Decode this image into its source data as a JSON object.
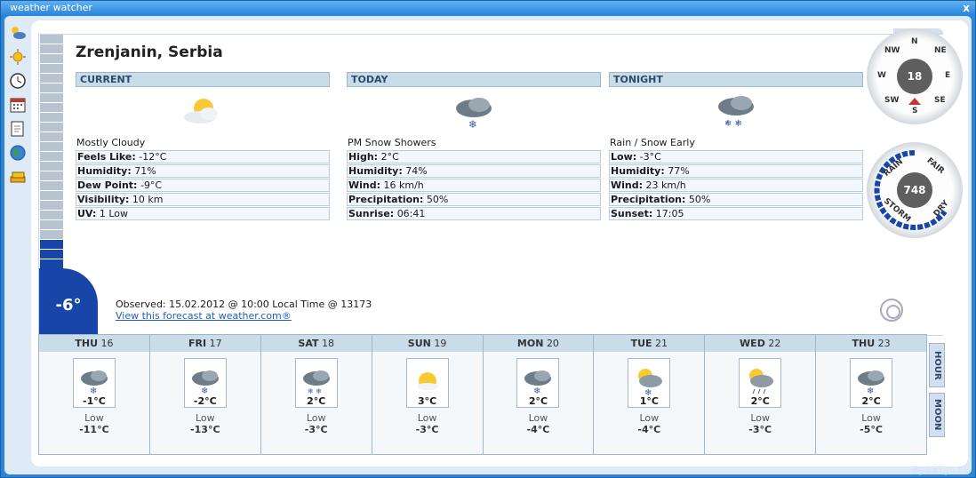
{
  "window": {
    "title": "weather watcher",
    "close": "x",
    "brand": "mycity.rs"
  },
  "toolbar": [
    "weather-icon",
    "sun-icon",
    "clock-icon",
    "calendar-icon",
    "notes-icon",
    "globe-icon",
    "stack-icon"
  ],
  "location": "Zrenjanin, Serbia",
  "temperature": "-6°",
  "current": {
    "header": "CURRENT",
    "icon": "partly-cloudy-icon",
    "condition": "Mostly Cloudy",
    "rows": [
      {
        "label": "Feels Like:",
        "value": "-12°C"
      },
      {
        "label": "Humidity:",
        "value": "71%"
      },
      {
        "label": "Dew Point:",
        "value": "-9°C"
      },
      {
        "label": "Visibility:",
        "value": "10 km"
      },
      {
        "label": "UV:",
        "value": "1 Low"
      }
    ]
  },
  "today": {
    "header": "TODAY",
    "icon": "snow-cloud-icon",
    "condition": "PM Snow Showers",
    "rows": [
      {
        "label": "High:",
        "value": "2°C"
      },
      {
        "label": "Humidity:",
        "value": " 74%"
      },
      {
        "label": "Wind:",
        "value": " 16 km/h"
      },
      {
        "label": "Precipitation:",
        "value": " 50%"
      },
      {
        "label": "Sunrise:",
        "value": "06:41"
      }
    ]
  },
  "tonight": {
    "header": "TONIGHT",
    "icon": "rain-snow-icon",
    "condition": "Rain / Snow Early",
    "rows": [
      {
        "label": "Low:",
        "value": "-3°C"
      },
      {
        "label": "Humidity:",
        "value": " 77%"
      },
      {
        "label": "Wind:",
        "value": " 23 km/h"
      },
      {
        "label": "Precipitation:",
        "value": " 50%"
      },
      {
        "label": "Sunset:",
        "value": "17:05"
      }
    ]
  },
  "observed": "Observed: 15.02.2012 @ 10:00 Local Time @ 13173",
  "link": "View this forecast at weather.com®",
  "compass": {
    "value": "18",
    "labels": [
      "N",
      "NE",
      "E",
      "SE",
      "S",
      "SW",
      "W",
      "NW"
    ]
  },
  "barometer": {
    "value": "748",
    "labels": [
      "RAIN",
      "FAIR",
      "STORM",
      "DRY"
    ]
  },
  "forecast": [
    {
      "day": "THU",
      "date": "16",
      "hi": "-1°C",
      "low_label": "Low",
      "lo": "-11°C",
      "icon": "snow-cloud-icon"
    },
    {
      "day": "FRI",
      "date": "17",
      "hi": "-2°C",
      "low_label": "Low",
      "lo": "-13°C",
      "icon": "snow-cloud-icon"
    },
    {
      "day": "SAT",
      "date": "18",
      "hi": "2°C",
      "low_label": "Low",
      "lo": "-3°C",
      "icon": "rain-snow-icon"
    },
    {
      "day": "SUN",
      "date": "19",
      "hi": "3°C",
      "low_label": "Low",
      "lo": "-3°C",
      "icon": "sun-icon"
    },
    {
      "day": "MON",
      "date": "20",
      "hi": "2°C",
      "low_label": "Low",
      "lo": "-4°C",
      "icon": "snow-cloud-icon"
    },
    {
      "day": "TUE",
      "date": "21",
      "hi": "1°C",
      "low_label": "Low",
      "lo": "-4°C",
      "icon": "sun-snow-icon"
    },
    {
      "day": "WED",
      "date": "22",
      "hi": "2°C",
      "low_label": "Low",
      "lo": "-3°C",
      "icon": "sun-rain-icon"
    },
    {
      "day": "THU",
      "date": "23",
      "hi": "2°C",
      "low_label": "Low",
      "lo": "-5°C",
      "icon": "snow-cloud-icon"
    }
  ],
  "tabs": {
    "hour": "HOUR",
    "moon": "MOON"
  }
}
